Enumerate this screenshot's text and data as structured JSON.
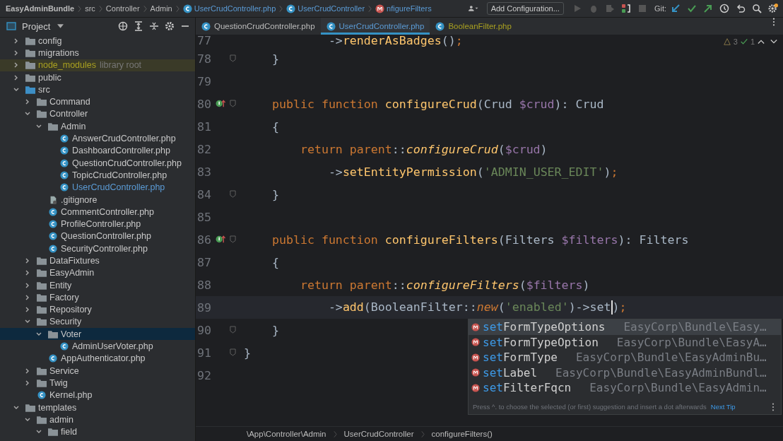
{
  "breadcrumbs": [
    {
      "label": "EasyAdminBundle",
      "kind": "project"
    },
    {
      "label": "src",
      "kind": "folder"
    },
    {
      "label": "Controller",
      "kind": "folder"
    },
    {
      "label": "Admin",
      "kind": "folder"
    },
    {
      "label": "UserCrudController.php",
      "kind": "file"
    },
    {
      "label": "UserCrudController",
      "kind": "class"
    },
    {
      "label": "nfigureFilters",
      "kind": "method"
    }
  ],
  "toolbar": {
    "run_config": "Add Configuration...",
    "git_label": "Git:"
  },
  "project_panel": {
    "title": "Project"
  },
  "tabs": [
    {
      "label": "QuestionCrudController.php",
      "selected": false,
      "library": false
    },
    {
      "label": "UserCrudController.php",
      "selected": true,
      "library": false
    },
    {
      "label": "BooleanFilter.php",
      "selected": false,
      "library": true
    }
  ],
  "inspections": {
    "warnings": "3",
    "passed": "1"
  },
  "tree": [
    {
      "name": "config",
      "kind": "folder",
      "expanded": false,
      "selected": false,
      "current": false
    },
    {
      "name": "migrations",
      "kind": "folder",
      "expanded": false,
      "selected": false,
      "current": false
    },
    {
      "name": "node_modules",
      "kind": "library",
      "suffix": "library root",
      "expanded": false,
      "selected": false,
      "current": false
    },
    {
      "name": "public",
      "kind": "folder",
      "expanded": false,
      "selected": false,
      "current": false
    },
    {
      "name": "src",
      "kind": "source",
      "expanded": true,
      "selected": false,
      "current": false,
      "children": [
        {
          "name": "Command",
          "kind": "folder",
          "expanded": false,
          "selected": false,
          "current": false
        },
        {
          "name": "Controller",
          "kind": "folder",
          "expanded": true,
          "selected": false,
          "current": false,
          "children": [
            {
              "name": "Admin",
              "kind": "folder",
              "expanded": true,
              "selected": false,
              "current": false,
              "children": [
                {
                  "name": "AnswerCrudController.php",
                  "kind": "php",
                  "selected": false,
                  "current": false
                },
                {
                  "name": "DashboardController.php",
                  "kind": "php",
                  "selected": false,
                  "current": false
                },
                {
                  "name": "QuestionCrudController.php",
                  "kind": "php",
                  "selected": false,
                  "current": false
                },
                {
                  "name": "TopicCrudController.php",
                  "kind": "php",
                  "selected": false,
                  "current": false
                },
                {
                  "name": "UserCrudController.php",
                  "kind": "php",
                  "selected": false,
                  "current": true
                }
              ]
            },
            {
              "name": ".gitignore",
              "kind": "text",
              "selected": false,
              "current": false
            },
            {
              "name": "CommentController.php",
              "kind": "php",
              "selected": false,
              "current": false
            },
            {
              "name": "ProfileController.php",
              "kind": "php",
              "selected": false,
              "current": false
            },
            {
              "name": "QuestionController.php",
              "kind": "php",
              "selected": false,
              "current": false
            },
            {
              "name": "SecurityController.php",
              "kind": "php",
              "selected": false,
              "current": false
            }
          ]
        },
        {
          "name": "DataFixtures",
          "kind": "folder",
          "expanded": false,
          "selected": false,
          "current": false
        },
        {
          "name": "EasyAdmin",
          "kind": "folder",
          "expanded": false,
          "selected": false,
          "current": false
        },
        {
          "name": "Entity",
          "kind": "folder",
          "expanded": false,
          "selected": false,
          "current": false
        },
        {
          "name": "Factory",
          "kind": "folder",
          "expanded": false,
          "selected": false,
          "current": false
        },
        {
          "name": "Repository",
          "kind": "folder",
          "expanded": false,
          "selected": false,
          "current": false
        },
        {
          "name": "Security",
          "kind": "folder",
          "expanded": true,
          "selected": false,
          "current": false,
          "children": [
            {
              "name": "Voter",
              "kind": "folder",
              "expanded": true,
              "selected": true,
              "current": false,
              "children": [
                {
                  "name": "AdminUserVoter.php",
                  "kind": "php",
                  "selected": false,
                  "current": false
                }
              ]
            },
            {
              "name": "AppAuthenticator.php",
              "kind": "php",
              "selected": false,
              "current": false
            }
          ]
        },
        {
          "name": "Service",
          "kind": "folder",
          "expanded": false,
          "selected": false,
          "current": false
        },
        {
          "name": "Twig",
          "kind": "folder",
          "expanded": false,
          "selected": false,
          "current": false
        },
        {
          "name": "Kernel.php",
          "kind": "php",
          "selected": false,
          "current": false
        }
      ]
    },
    {
      "name": "templates",
      "kind": "folder",
      "expanded": true,
      "selected": false,
      "current": false,
      "children": [
        {
          "name": "admin",
          "kind": "folder",
          "expanded": true,
          "selected": false,
          "current": false,
          "children": [
            {
              "name": "field",
              "kind": "folder",
              "expanded": true,
              "selected": false,
              "current": false
            }
          ]
        }
      ]
    }
  ],
  "code": [
    {
      "number": "77",
      "override": false,
      "fold": false,
      "current": false,
      "tokens": [
        {
          "kind": "plain",
          "text": "            ->"
        },
        {
          "kind": "fn",
          "text": "renderAsBadges"
        },
        {
          "kind": "plain",
          "text": "()"
        },
        {
          "kind": "semi",
          "text": ";"
        }
      ]
    },
    {
      "number": "78",
      "override": false,
      "fold": true,
      "current": false,
      "tokens": [
        {
          "kind": "plain",
          "text": "    }"
        }
      ]
    },
    {
      "number": "79",
      "override": false,
      "fold": false,
      "current": false
    },
    {
      "number": "80",
      "override": true,
      "fold": true,
      "current": false,
      "tokens": [
        {
          "kind": "kw",
          "text": "    public function "
        },
        {
          "kind": "fn",
          "text": "configureCrud"
        },
        {
          "kind": "plain",
          "text": "(Crud "
        },
        {
          "kind": "var",
          "text": "$crud"
        },
        {
          "kind": "plain",
          "text": "): Crud"
        }
      ]
    },
    {
      "number": "81",
      "override": false,
      "fold": false,
      "current": false,
      "tokens": [
        {
          "kind": "plain",
          "text": "    {"
        }
      ]
    },
    {
      "number": "82",
      "override": false,
      "fold": false,
      "current": false,
      "tokens": [
        {
          "kind": "kw",
          "text": "        return parent"
        },
        {
          "kind": "plain",
          "text": "::"
        },
        {
          "kind": "fni",
          "text": "configureCrud"
        },
        {
          "kind": "plain",
          "text": "("
        },
        {
          "kind": "var",
          "text": "$crud"
        },
        {
          "kind": "plain",
          "text": ")"
        }
      ]
    },
    {
      "number": "83",
      "override": false,
      "fold": false,
      "current": false,
      "tokens": [
        {
          "kind": "plain",
          "text": "            ->"
        },
        {
          "kind": "fn",
          "text": "setEntityPermission"
        },
        {
          "kind": "plain",
          "text": "("
        },
        {
          "kind": "str",
          "text": "'ADMIN_USER_EDIT'"
        },
        {
          "kind": "plain",
          "text": ")"
        },
        {
          "kind": "semi",
          "text": ";"
        }
      ]
    },
    {
      "number": "84",
      "override": false,
      "fold": true,
      "current": false,
      "tokens": [
        {
          "kind": "plain",
          "text": "    }"
        }
      ]
    },
    {
      "number": "85",
      "override": false,
      "fold": false,
      "current": false
    },
    {
      "number": "86",
      "override": true,
      "fold": true,
      "current": false,
      "tokens": [
        {
          "kind": "kw",
          "text": "    public function "
        },
        {
          "kind": "fn",
          "text": "configureFilters"
        },
        {
          "kind": "plain",
          "text": "(Filters "
        },
        {
          "kind": "var",
          "text": "$filters"
        },
        {
          "kind": "plain",
          "text": "): Filters"
        }
      ]
    },
    {
      "number": "87",
      "override": false,
      "fold": false,
      "current": false,
      "tokens": [
        {
          "kind": "plain",
          "text": "    {"
        }
      ]
    },
    {
      "number": "88",
      "override": false,
      "fold": false,
      "current": false,
      "tokens": [
        {
          "kind": "kw",
          "text": "        return parent"
        },
        {
          "kind": "plain",
          "text": "::"
        },
        {
          "kind": "fni",
          "text": "configureFilters"
        },
        {
          "kind": "plain",
          "text": "("
        },
        {
          "kind": "var",
          "text": "$filters"
        },
        {
          "kind": "plain",
          "text": ")"
        }
      ]
    },
    {
      "number": "89",
      "override": false,
      "fold": false,
      "current": true,
      "tokens": [
        {
          "kind": "plain",
          "text": "            ->"
        },
        {
          "kind": "fn",
          "text": "add"
        },
        {
          "kind": "plain",
          "text": "(BooleanFilter::"
        },
        {
          "kind": "kwi",
          "text": "new"
        },
        {
          "kind": "plain",
          "text": "("
        },
        {
          "kind": "str",
          "text": "'enabled'"
        },
        {
          "kind": "plain",
          "text": ")->set"
        },
        {
          "kind": "caret"
        },
        {
          "kind": "plain",
          "text": ")"
        },
        {
          "kind": "semi",
          "text": ";"
        }
      ]
    },
    {
      "number": "90",
      "override": false,
      "fold": true,
      "current": false,
      "tokens": [
        {
          "kind": "plain",
          "text": "    }"
        }
      ]
    },
    {
      "number": "91",
      "override": false,
      "fold": true,
      "current": false,
      "tokens": [
        {
          "kind": "plain",
          "text": "}"
        }
      ]
    },
    {
      "number": "92",
      "override": false,
      "fold": false,
      "current": false
    }
  ],
  "completion": {
    "items": [
      {
        "match": "set",
        "rest": "FormTypeOptions",
        "location": "EasyCorp\\Bundle\\Easy…",
        "selected": true
      },
      {
        "match": "set",
        "rest": "FormTypeOption",
        "location": "EasyCorp\\Bundle\\EasyA…",
        "selected": false
      },
      {
        "match": "set",
        "rest": "FormType",
        "location": "EasyCorp\\Bundle\\EasyAdminBu…",
        "selected": false
      },
      {
        "match": "set",
        "rest": "Label",
        "location": "EasyCorp\\Bundle\\EasyAdminBundl…",
        "selected": false
      },
      {
        "match": "set",
        "rest": "FilterFqcn",
        "location": "EasyCorp\\Bundle\\EasyAdmin…",
        "selected": false
      }
    ],
    "hint": "Press ^. to choose the selected (or first) suggestion and insert a dot afterwards",
    "next_tip": "Next Tip"
  },
  "status_path": [
    "\\App\\Controller\\Admin",
    "UserCrudController",
    "configureFilters()"
  ]
}
